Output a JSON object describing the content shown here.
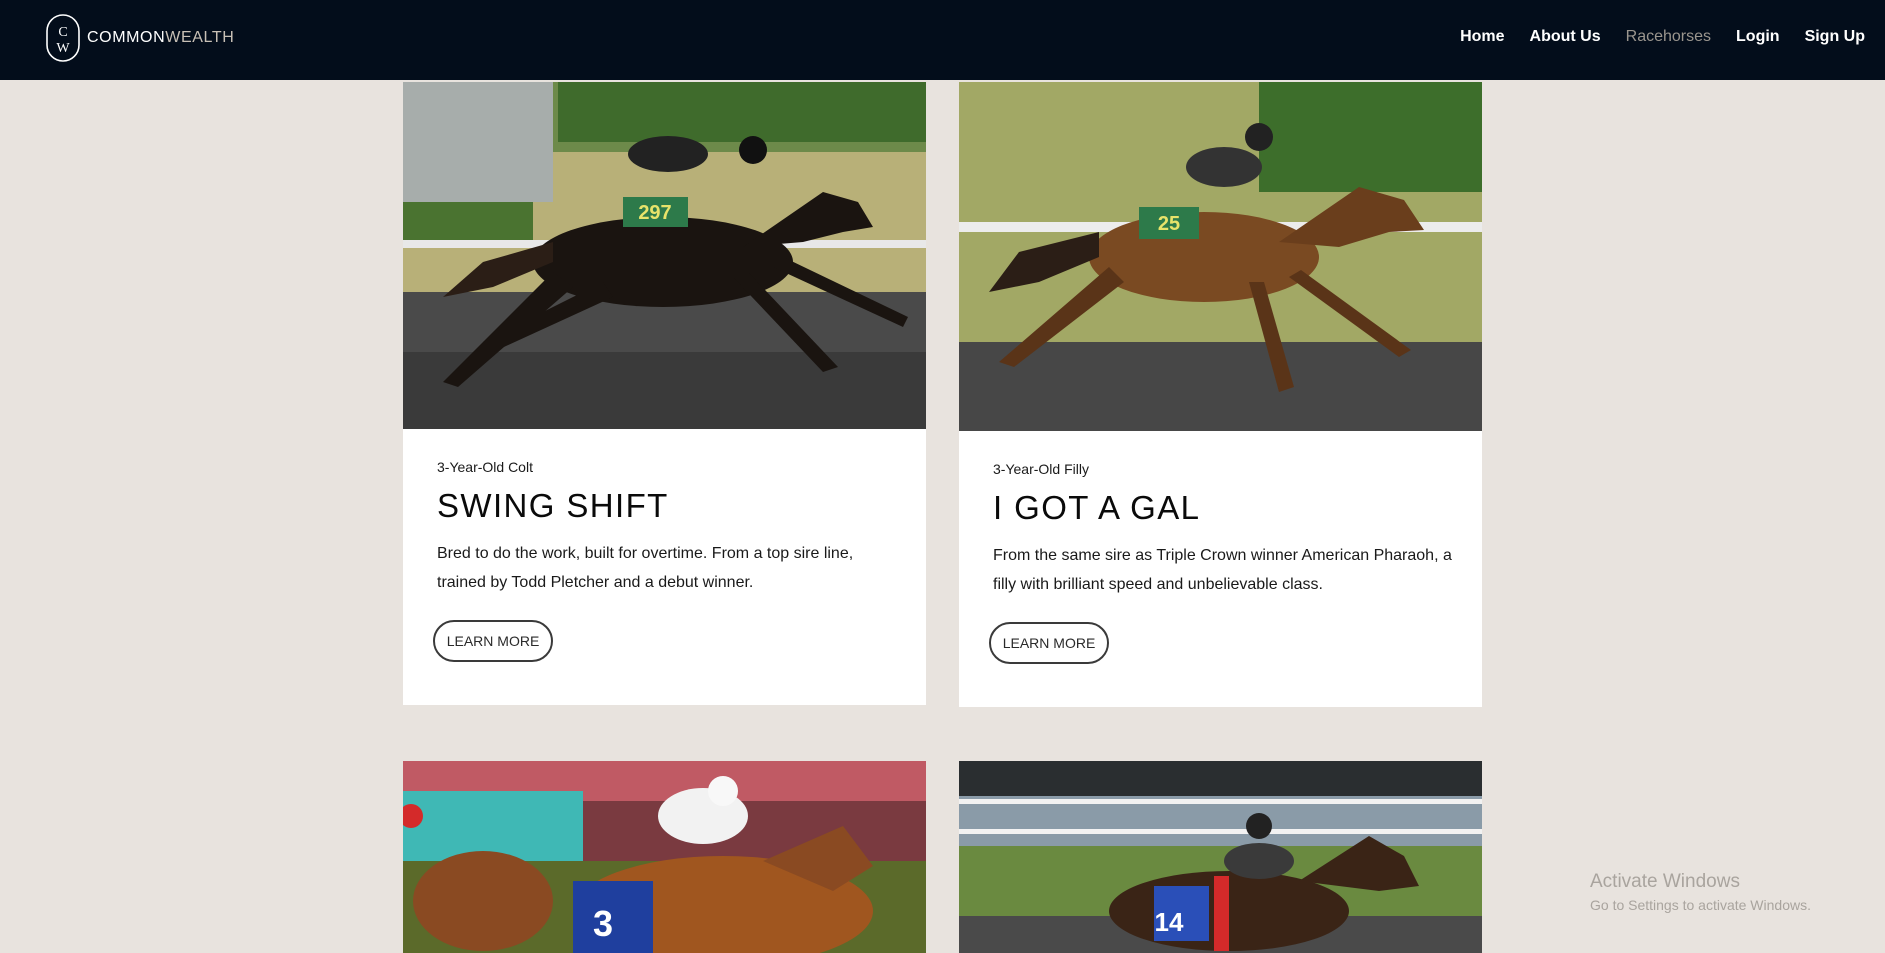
{
  "brand": {
    "name_part1": "COMMON",
    "name_part2": "WEALTH",
    "colors": {
      "header": "#030d1b",
      "page_bg": "#e8e3de",
      "card": "#ffffff",
      "nav_active": "#9a958e"
    }
  },
  "nav": [
    {
      "label": "Home",
      "active": false
    },
    {
      "label": "About Us",
      "active": false
    },
    {
      "label": "Racehorses",
      "active": true
    },
    {
      "label": "Login",
      "active": false
    },
    {
      "label": "Sign Up",
      "active": false
    }
  ],
  "horses": [
    {
      "subtitle": "3-Year-Old Colt",
      "name": "SWING SHIFT",
      "description": "Bred to do the work, built for overtime. From a top sire line, trained by Todd Pletcher and a debut winner.",
      "button": "LEARN MORE",
      "saddle_number": "297"
    },
    {
      "subtitle": "3-Year-Old Filly",
      "name": "I GOT A GAL",
      "description": "From the same sire as Triple Crown winner American Pharaoh, a filly with brilliant speed and unbelievable class.",
      "button": "LEARN MORE",
      "saddle_number": "25"
    },
    {
      "saddle_number": "3"
    },
    {
      "saddle_number": "14"
    }
  ],
  "watermark": {
    "line1": "Activate Windows",
    "line2": "Go to Settings to activate Windows."
  }
}
